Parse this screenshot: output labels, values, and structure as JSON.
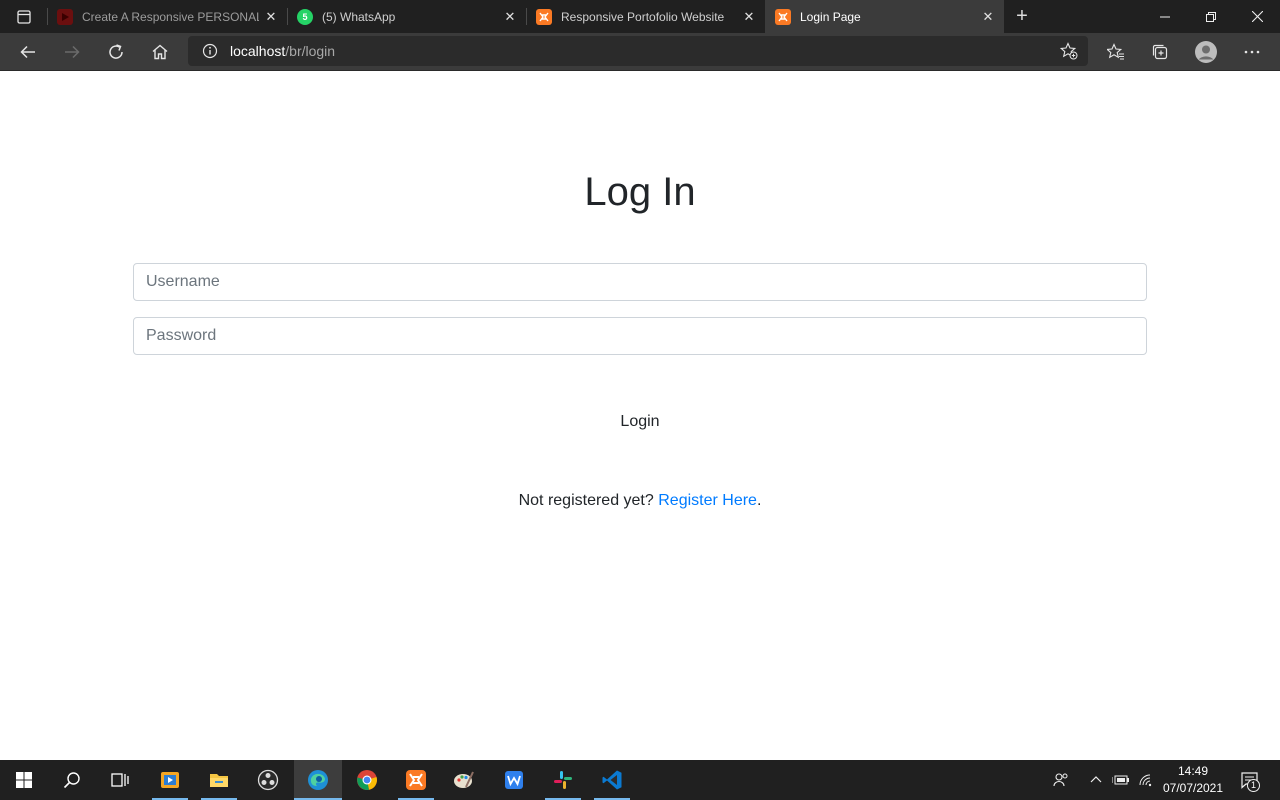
{
  "browser": {
    "tabs": [
      {
        "title": "Create A Responsive PERSONAL",
        "favicon": "youtube-icon",
        "active": false
      },
      {
        "title": "(5) WhatsApp",
        "favicon": "whatsapp-icon",
        "badge": "5",
        "active": false
      },
      {
        "title": "Responsive Portofolio Website",
        "favicon": "xampp-icon",
        "active": false
      },
      {
        "title": "Login Page",
        "favicon": "xampp-icon",
        "active": true
      }
    ],
    "address": {
      "host": "localhost",
      "path": "/br/login"
    }
  },
  "page": {
    "heading": "Log In",
    "username_placeholder": "Username",
    "password_placeholder": "Password",
    "login_label": "Login",
    "register_prompt": "Not registered yet?",
    "register_link": "Register Here",
    "register_suffix": "."
  },
  "taskbar": {
    "apps": [
      "media-player-icon",
      "file-explorer-icon",
      "obs-icon",
      "edge-icon",
      "chrome-icon",
      "xampp-icon",
      "paint-icon",
      "wps-icon",
      "slack-icon",
      "vscode-icon"
    ],
    "time": "14:49",
    "date": "07/07/2021",
    "notification_count": "1"
  },
  "colors": {
    "link": "#007bff",
    "heading": "#212529",
    "input_border": "#ced4da",
    "tab_bar": "#202020",
    "toolbar": "#3b3b3b",
    "taskbar": "#202020"
  }
}
